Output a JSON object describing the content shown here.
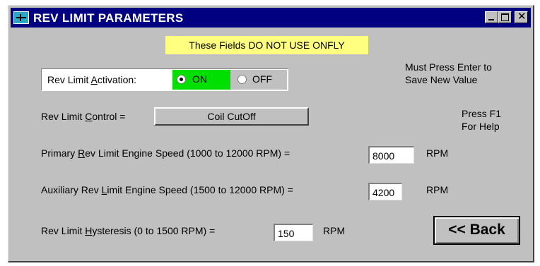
{
  "window": {
    "title": "REV LIMIT PARAMETERS"
  },
  "warning": "These Fields DO NOT USE ONFLY",
  "activation": {
    "label_pre": "Rev Limit ",
    "label_u": "A",
    "label_post": "ctivation:",
    "on_label": "ON",
    "off_label": "OFF",
    "selected": "ON"
  },
  "note_enter": [
    "Must Press Enter to",
    "Save New Value"
  ],
  "note_help": [
    "Press F1",
    "For Help"
  ],
  "control": {
    "label_pre": "Rev Limit ",
    "label_u": "C",
    "label_post": "ontrol =",
    "button": "Coil CutOff"
  },
  "primary": {
    "label_pre": "Primary ",
    "label_u": "R",
    "label_post": "ev Limit Engine Speed (1000  to 12000 RPM) =",
    "value": "8000",
    "unit": "RPM"
  },
  "auxiliary": {
    "label_pre": "Auxiliary Rev ",
    "label_u": "L",
    "label_post": "imit Engine Speed (1500 to 12000 RPM) =",
    "value": "4200",
    "unit": "RPM"
  },
  "hysteresis": {
    "label_pre": "Rev Limit ",
    "label_u": "H",
    "label_post": "ysteresis (0 to 1500 RPM) =",
    "value": "150",
    "unit": "RPM"
  },
  "back_button": "<< Back",
  "colors": {
    "titlebar": "#000080",
    "warning_bg": "#ffff80",
    "on_highlight": "#00e000"
  }
}
